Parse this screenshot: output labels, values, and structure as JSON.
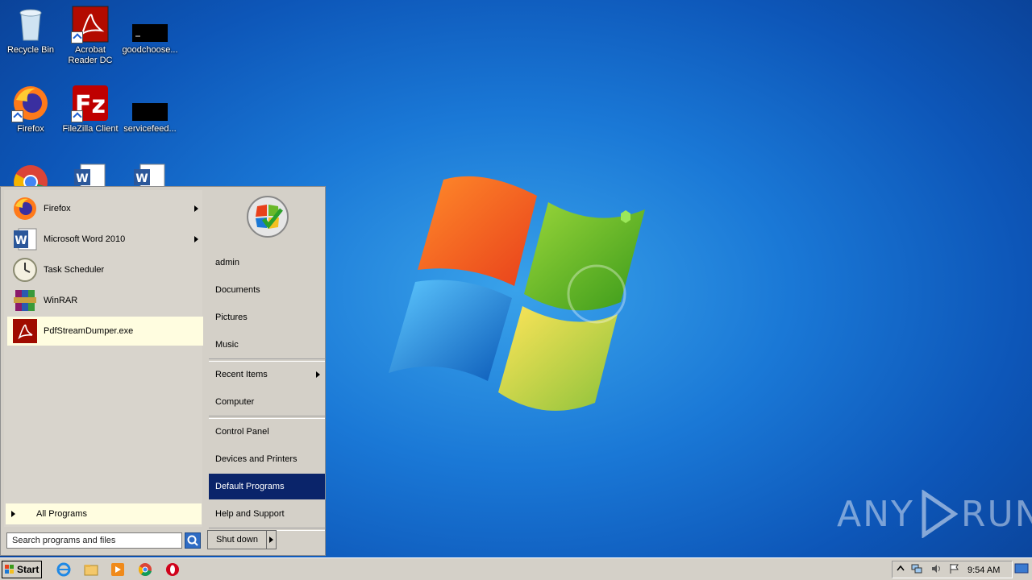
{
  "desktop": {
    "icons": [
      {
        "label": "Recycle Bin",
        "icon": "recycle-bin-icon"
      },
      {
        "label": "Acrobat Reader DC",
        "line1": "Acrobat",
        "line2": "Reader DC",
        "icon": "acrobat-icon"
      },
      {
        "label": "goodchoose...",
        "icon": "redacted-file-icon"
      },
      {
        "label": "Firefox",
        "icon": "firefox-icon"
      },
      {
        "label": "FileZilla Client",
        "icon": "filezilla-icon"
      },
      {
        "label": "servicefeed...",
        "icon": "redacted-file-icon"
      },
      {
        "label": "",
        "icon": "chrome-icon"
      },
      {
        "label": "",
        "icon": "word-document-icon"
      },
      {
        "label": "",
        "icon": "word-document-icon"
      }
    ],
    "watermark": "ANY RUN",
    "watermark_left": "ANY",
    "watermark_right": "RUN"
  },
  "start_menu": {
    "programs": [
      {
        "label": "Firefox",
        "icon": "firefox-icon",
        "has_submenu": true
      },
      {
        "label": "Microsoft Word 2010",
        "icon": "word-icon",
        "has_submenu": true
      },
      {
        "label": "Task Scheduler",
        "icon": "clock-icon",
        "has_submenu": false
      },
      {
        "label": "WinRAR",
        "icon": "winrar-icon",
        "has_submenu": false
      },
      {
        "label": "PdfStreamDumper.exe",
        "icon": "pdf-icon",
        "has_submenu": false,
        "highlighted": true
      }
    ],
    "all_programs": "All Programs",
    "search_placeholder": "Search programs and files",
    "right_items": [
      {
        "label": "admin"
      },
      {
        "label": "Documents"
      },
      {
        "label": "Pictures"
      },
      {
        "label": "Music"
      },
      {
        "label": "Recent Items",
        "has_submenu": true
      },
      {
        "label": "Computer"
      },
      {
        "label": "Control Panel"
      },
      {
        "label": "Devices and Printers"
      },
      {
        "label": "Default Programs",
        "selected": true
      },
      {
        "label": "Help and Support"
      }
    ],
    "shutdown": "Shut down"
  },
  "taskbar": {
    "start_label": "Start",
    "pinned": [
      "internet-explorer-icon",
      "folder-icon",
      "media-player-icon",
      "chrome-icon",
      "opera-icon"
    ],
    "clock": "9:54 AM"
  },
  "colors": {
    "selection": "#0a246a",
    "highlight": "#fffde0",
    "taskbar": "#d4d0c8"
  }
}
